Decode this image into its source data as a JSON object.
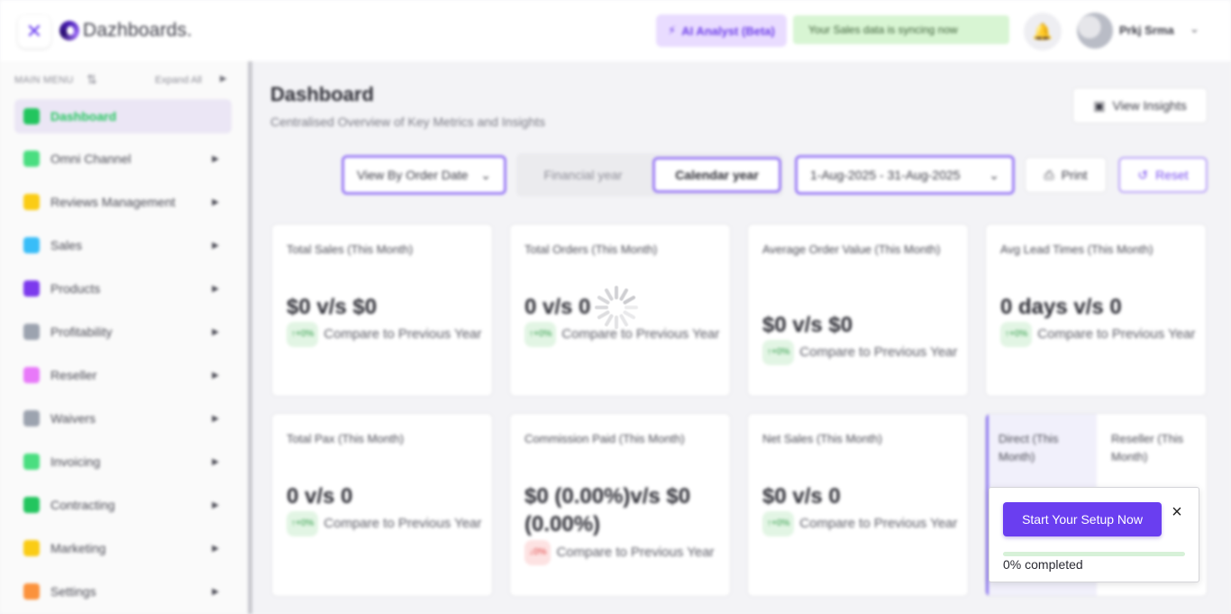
{
  "header": {
    "logo_text": "Dazhboards.",
    "ai_button": "AI Analyst (Beta)",
    "sync_status": "Your Sales data is syncing now",
    "user_name": "Prkj Srma"
  },
  "sidebar": {
    "menu_heading": "MAIN MENU",
    "expand_all": "Expand All",
    "items": [
      {
        "label": "Dashboard",
        "icon": "home-icon",
        "color": "#22c55e",
        "active": true
      },
      {
        "label": "Omni Channel",
        "icon": "calendar-icon",
        "color": "#4ade80"
      },
      {
        "label": "Reviews Management",
        "icon": "message-icon",
        "color": "#facc15"
      },
      {
        "label": "Sales",
        "icon": "chart-icon",
        "color": "#38bdf8"
      },
      {
        "label": "Products",
        "icon": "box-icon",
        "color": "#7c3aed"
      },
      {
        "label": "Profitability",
        "icon": "lock-icon",
        "color": "#9ca3af"
      },
      {
        "label": "Reseller",
        "icon": "inbox-icon",
        "color": "#e879f9"
      },
      {
        "label": "Waivers",
        "icon": "document-icon",
        "color": "#9ca3af"
      },
      {
        "label": "Invoicing",
        "icon": "invoice-icon",
        "color": "#4ade80"
      },
      {
        "label": "Contracting",
        "icon": "contract-icon",
        "color": "#22c55e"
      },
      {
        "label": "Marketing",
        "icon": "megaphone-icon",
        "color": "#facc15"
      },
      {
        "label": "Settings",
        "icon": "gear-icon",
        "color": "#fb923c"
      }
    ]
  },
  "main": {
    "title": "Dashboard",
    "subtitle": "Centralised Overview of Key Metrics and Insights",
    "view_insights": "View Insights",
    "filters": {
      "view_by": "View By Order Date",
      "financial_year": "Financial year",
      "calendar_year": "Calendar year",
      "date_range": "1-Aug-2025 - 31-Aug-2025",
      "print": "Print",
      "reset": "Reset"
    },
    "cards": [
      {
        "title": "Total Sales (This Month)",
        "value": "$0 v/s $0",
        "badge": "↑+0%",
        "badge_type": "green",
        "compare": "Compare to Previous Year"
      },
      {
        "title": "Total Orders (This Month)",
        "value": "0 v/s 0",
        "badge": "↑+0%",
        "badge_type": "green",
        "compare": "Compare to Previous Year"
      },
      {
        "title": "Average Order Value (This Month)",
        "value": "$0 v/s $0",
        "badge": "↑+0%",
        "badge_type": "green",
        "compare": "Compare to Previous Year"
      },
      {
        "title": "Avg Lead Times (This Month)",
        "value": "0 days v/s 0",
        "badge": "↑+0%",
        "badge_type": "green",
        "compare": "Compare to Previous Year"
      },
      {
        "title": "Total Pax (This Month)",
        "value": "0 v/s 0",
        "badge": "↑+0%",
        "badge_type": "green",
        "compare": "Compare to Previous Year"
      },
      {
        "title": "Commission Paid (This Month)",
        "value": "$0 (0.00%)v/s $0 (0.00%)",
        "badge": "↓0%",
        "badge_type": "red",
        "compare": "Compare to Previous Year"
      },
      {
        "title": "Net Sales (This Month)",
        "value": "$0 v/s 0",
        "badge": "↑+0%",
        "badge_type": "green",
        "compare": "Compare to Previous Year"
      }
    ],
    "split_card": {
      "left_title": "Direct (This Month)",
      "right_title": "Reseller (This Month)"
    }
  },
  "setup_popup": {
    "button": "Start Your Setup Now",
    "progress_label": "0% completed",
    "progress_fraction": 0.0
  }
}
